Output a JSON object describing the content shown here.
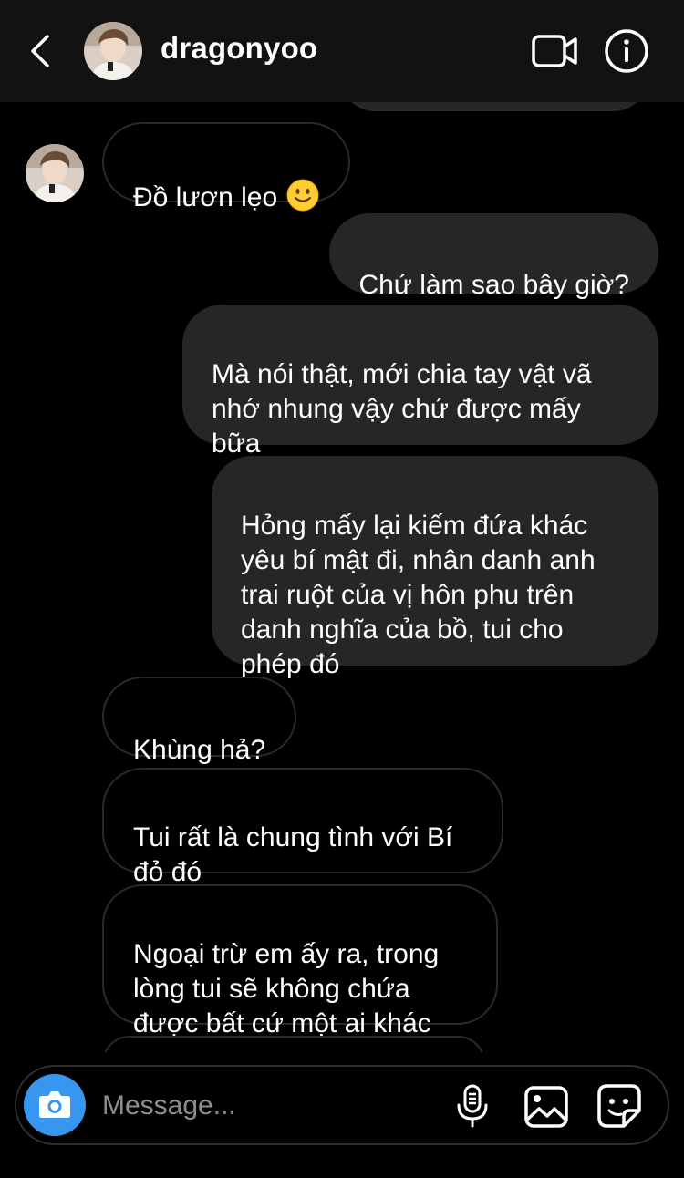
{
  "header": {
    "username": "dragonyoo",
    "back_icon": "chevron-left-icon",
    "video_icon": "video-camera-icon",
    "info_icon": "info-icon"
  },
  "messages": [
    {
      "direction": "in",
      "text": "Đồ lươn lẹo",
      "emoji": "slightly-smiling-face"
    },
    {
      "direction": "out",
      "text": "Chứ làm sao bây giờ?"
    },
    {
      "direction": "out",
      "text": "Mà nói thật, mới chia tay vật vã\nnhớ nhung vậy chứ được mấy\nbữa"
    },
    {
      "direction": "out",
      "text": "Hỏng mấy lại kiếm đứa khác\nyêu bí mật đi, nhân danh anh\ntrai ruột của vị hôn phu trên\ndanh nghĩa của bồ, tui cho\nphép đó"
    },
    {
      "direction": "in",
      "text": "Khùng hả?"
    },
    {
      "direction": "in",
      "text": "Tui rất là chung tình với Bí\nđỏ đó"
    },
    {
      "direction": "in",
      "text": "Ngoại trừ em ấy ra, trong\nlòng tui sẽ không chứa\nđược bất cứ một ai khác"
    }
  ],
  "composer": {
    "placeholder": "Message...",
    "camera_icon": "camera-icon",
    "mic_icon": "microphone-icon",
    "gallery_icon": "image-gallery-icon",
    "sticker_icon": "sticker-icon"
  },
  "colors": {
    "background": "#000000",
    "header_bg": "#121212",
    "outgoing_bubble": "#262626",
    "incoming_border": "#2a2a2a",
    "accent": "#3797f0",
    "placeholder": "#8e8e8e"
  }
}
